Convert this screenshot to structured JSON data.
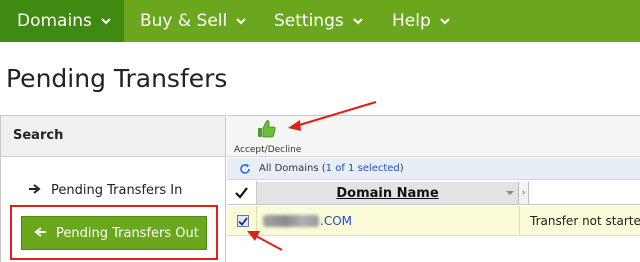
{
  "nav": {
    "items": [
      {
        "label": "Domains"
      },
      {
        "label": "Buy & Sell"
      },
      {
        "label": "Settings"
      },
      {
        "label": "Help"
      }
    ]
  },
  "page": {
    "title": "Pending Transfers"
  },
  "sidebar": {
    "search_label": "Search",
    "items": [
      {
        "label": "Pending Transfers In"
      },
      {
        "label": "Pending Transfers Out"
      }
    ]
  },
  "toolbar": {
    "accept_label": "Accept/Decline"
  },
  "summary": {
    "prefix": "All Domains (",
    "selection": "1 of 1 selected",
    "suffix": ")"
  },
  "grid": {
    "columns": {
      "domain": "Domain Name",
      "more": "›"
    },
    "rows": [
      {
        "domain_suffix": ".COM",
        "status": "Transfer not starte",
        "checked": true
      }
    ]
  },
  "colors": {
    "nav_green": "#6aa71d",
    "nav_active": "#3f8a10",
    "annotation_red": "#e0201b",
    "row_highlight": "#fcfbd9",
    "link_blue": "#1d4fbd"
  }
}
